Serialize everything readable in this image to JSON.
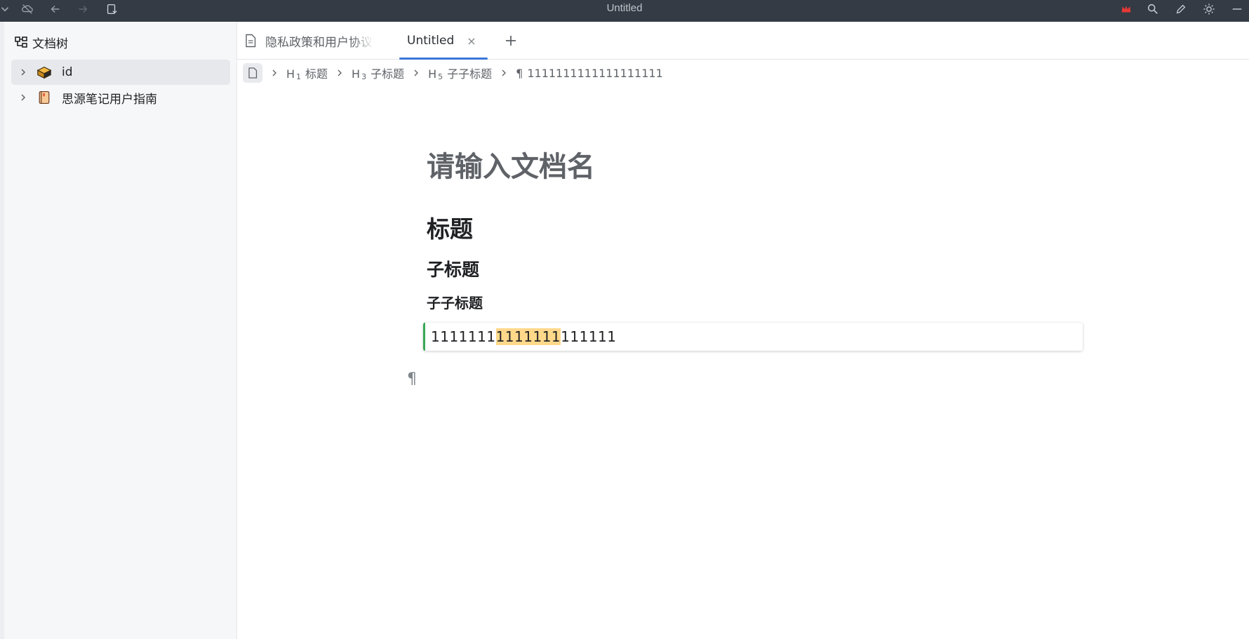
{
  "window": {
    "title": "Untitled"
  },
  "sidebar": {
    "header_label": "文档树",
    "items": [
      {
        "label": "id",
        "icon": "notebook-box-icon",
        "active": true
      },
      {
        "label": "思源笔记用户指南",
        "icon": "notebook-book-icon",
        "active": false
      }
    ]
  },
  "tabs": [
    {
      "label": "隐私政策和用户协议",
      "active": false
    },
    {
      "label": "Untitled",
      "active": true,
      "close": "×"
    }
  ],
  "breadcrumb": [
    {
      "prefix": "H",
      "level": "1",
      "label": "标题"
    },
    {
      "prefix": "H",
      "level": "3",
      "label": "子标题"
    },
    {
      "prefix": "H",
      "level": "5",
      "label": "子子标题"
    },
    {
      "prefix": "¶",
      "level": "",
      "label": "1111111111111111111"
    }
  ],
  "editor": {
    "doc_title_placeholder": "请输入文档名",
    "h1": "标题",
    "h3": "子标题",
    "h5": "子子标题",
    "paragraph_before": "1111111",
    "paragraph_highlight": "1111111",
    "paragraph_after": "111111",
    "empty_block_marker": "¶"
  },
  "colors": {
    "topbar_bg": "#343b45",
    "accent": "#3a76d8",
    "highlight": "#ffd88a",
    "block_border": "#3aa757"
  }
}
